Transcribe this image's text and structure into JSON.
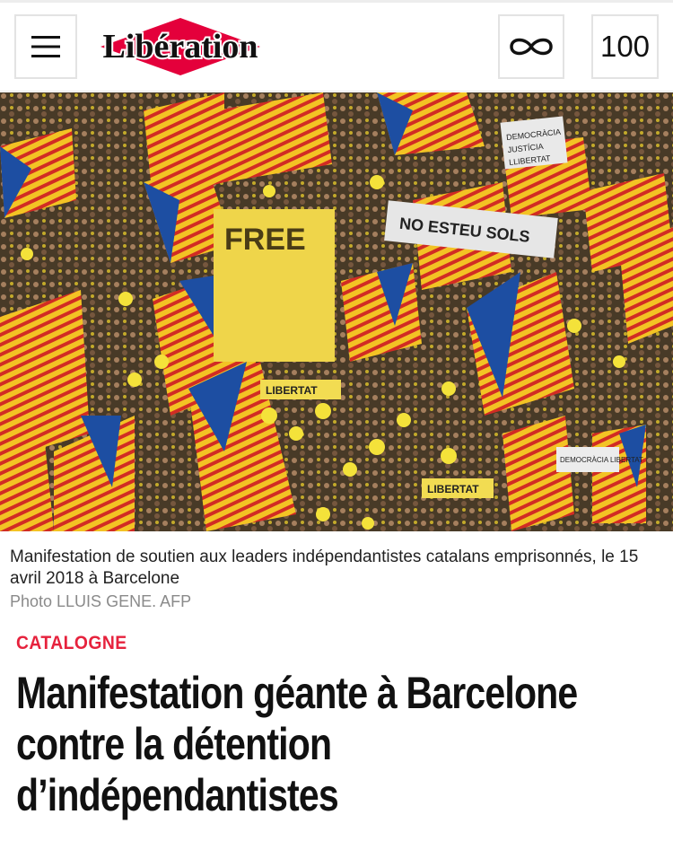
{
  "header": {
    "menu_icon": "hamburger-menu-icon",
    "logo_text": "Libération",
    "infinity_icon": "infinity-icon",
    "badge_label": "100"
  },
  "hero": {
    "banner_texts": [
      "FREE",
      "DEMOCRÀCIA",
      "JUSTÍCIA",
      "LLIBERTAT",
      "NO ESTEU SOLS",
      "LIBERTAT",
      "LIBERTAT",
      "DEMOCRÀCIA LIBERTAT"
    ]
  },
  "article": {
    "caption": "Manifestation de soutien aux leaders indépendantistes catalans emprisonnés, le 15 avril 2018 à Barcelone",
    "credit": "Photo LLUIS GENE. AFP",
    "section": "CATALOGNE",
    "headline": "Manifestation géante à Barcelone contre la détention d’indépendantistes"
  },
  "colors": {
    "accent": "#e6223d",
    "logo_red": "#e4003b",
    "flag_yellow": "#f3c324",
    "flag_red": "#d12c24",
    "flag_blue": "#1d4ea2"
  }
}
